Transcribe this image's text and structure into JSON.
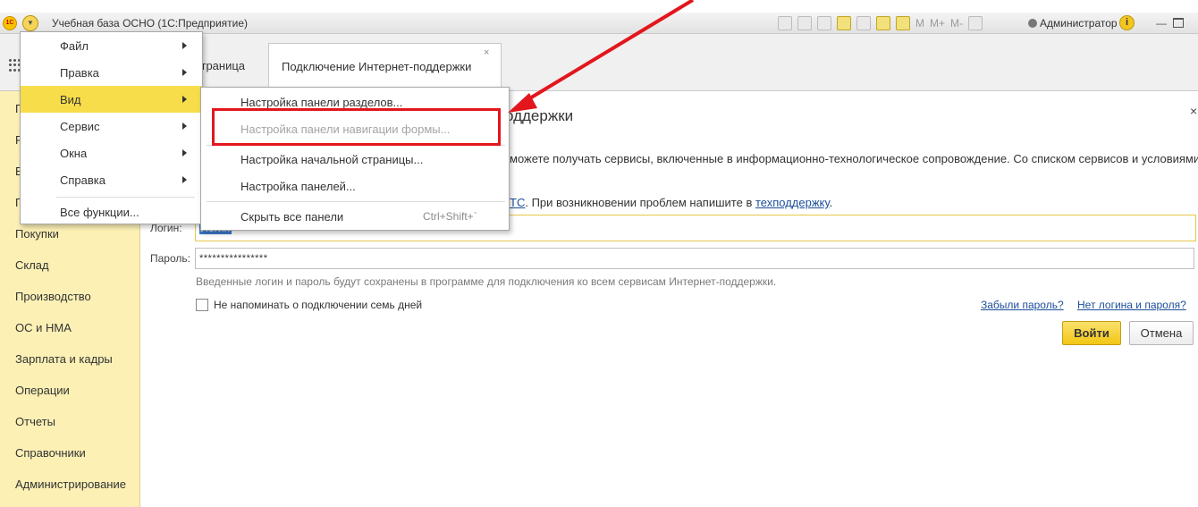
{
  "app": {
    "window_title": "Учебная база ОСНО  (1С:Предприятие)",
    "logo_text": "1С",
    "user": "Администратор",
    "info_symbol": "i",
    "toolbar_text": [
      "M",
      "M+",
      "M-"
    ]
  },
  "tabs": {
    "start_page": "страница",
    "active": "Подключение Интернет-поддержки",
    "close_symbol": "×"
  },
  "sidebar": {
    "items": [
      {
        "label": "П"
      },
      {
        "label": "Р"
      },
      {
        "label": "Б"
      },
      {
        "label": "П"
      },
      {
        "label": "Покупки"
      },
      {
        "label": "Склад"
      },
      {
        "label": "Производство"
      },
      {
        "label": "ОС и НМА"
      },
      {
        "label": "Зарплата и кадры"
      },
      {
        "label": "Операции"
      },
      {
        "label": "Отчеты"
      },
      {
        "label": "Справочники"
      },
      {
        "label": "Администрирование"
      }
    ]
  },
  "form": {
    "title": "оддержки",
    "close_symbol": "×",
    "desc_line1": "можете получать сервисы, включенные в информационно-технологическое сопровождение. Со списком сервисов и условиями",
    "desc_line2_link1": "ТС",
    "desc_line2_text": ". При возникновении проблем напишите в ",
    "desc_line2_link2": "техподдержку",
    "desc_line2_end": ".",
    "login_label": "Логин:",
    "login_value": "Логин",
    "password_label": "Пароль:",
    "password_value": "****************",
    "note": "Введенные логин и пароль будут сохранены в программе для подключения ко всем сервисам Интернет-поддержки.",
    "remind_label": "Не напоминать о подключении семь дней",
    "remind_checked": false,
    "forgot_link": "Забыли пароль?",
    "nologin_link": "Нет логина и пароля?",
    "login_button": "Войти",
    "cancel_button": "Отмена"
  },
  "main_menu": {
    "items": [
      {
        "label": "Файл",
        "has_submenu": true
      },
      {
        "label": "Правка",
        "has_submenu": true
      },
      {
        "label": "Вид",
        "has_submenu": true,
        "active": true
      },
      {
        "label": "Сервис",
        "has_submenu": true
      },
      {
        "label": "Окна",
        "has_submenu": true
      },
      {
        "label": "Справка",
        "has_submenu": true
      }
    ],
    "all_functions": "Все функции..."
  },
  "view_submenu": {
    "items": [
      {
        "label": "Настройка панели разделов..."
      },
      {
        "label": "Настройка панели навигации формы...",
        "disabled": true,
        "highlighted": true
      },
      {
        "label": "Настройка начальной страницы..."
      },
      {
        "label": "Настройка панелей..."
      },
      {
        "label": "Скрыть все панели",
        "shortcut": "Ctrl+Shift+`"
      }
    ]
  },
  "annotation": {
    "color": "#e3161d"
  },
  "colors": {
    "sidebar_bg": "#fcf0b5",
    "menu_active": "#f8dd4a",
    "link": "#1c4e9a",
    "login_button": "#f2c614"
  }
}
